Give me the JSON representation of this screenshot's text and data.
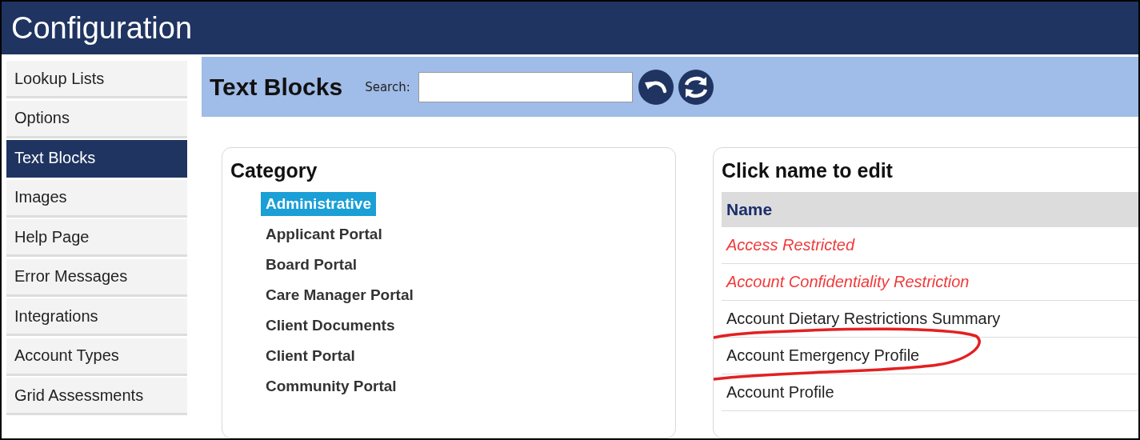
{
  "window": {
    "title": "Configuration"
  },
  "sidebar": {
    "items": [
      {
        "label": "Lookup Lists",
        "selected": false
      },
      {
        "label": "Options",
        "selected": false
      },
      {
        "label": "Text Blocks",
        "selected": true
      },
      {
        "label": "Images",
        "selected": false
      },
      {
        "label": "Help Page",
        "selected": false
      },
      {
        "label": "Error Messages",
        "selected": false
      },
      {
        "label": "Integrations",
        "selected": false
      },
      {
        "label": "Account Types",
        "selected": false
      },
      {
        "label": "Grid Assessments",
        "selected": false
      }
    ]
  },
  "header": {
    "title": "Text Blocks",
    "search_label": "Search:"
  },
  "category": {
    "title": "Category",
    "items": [
      {
        "label": "Administrative",
        "selected": true
      },
      {
        "label": "Applicant Portal",
        "selected": false
      },
      {
        "label": "Board Portal",
        "selected": false
      },
      {
        "label": "Care Manager Portal",
        "selected": false
      },
      {
        "label": "Client Documents",
        "selected": false
      },
      {
        "label": "Client Portal",
        "selected": false
      },
      {
        "label": "Community Portal",
        "selected": false
      }
    ]
  },
  "names": {
    "title": "Click name to edit",
    "column": "Name",
    "rows": [
      {
        "name": "Access Restricted",
        "flagged": true
      },
      {
        "name": "Account Confidentiality Restriction",
        "flagged": true
      },
      {
        "name": "Account Dietary Restrictions Summary",
        "flagged": false
      },
      {
        "name": "Account Emergency Profile",
        "flagged": false,
        "circled": true
      },
      {
        "name": "Account Profile",
        "flagged": false
      }
    ]
  }
}
